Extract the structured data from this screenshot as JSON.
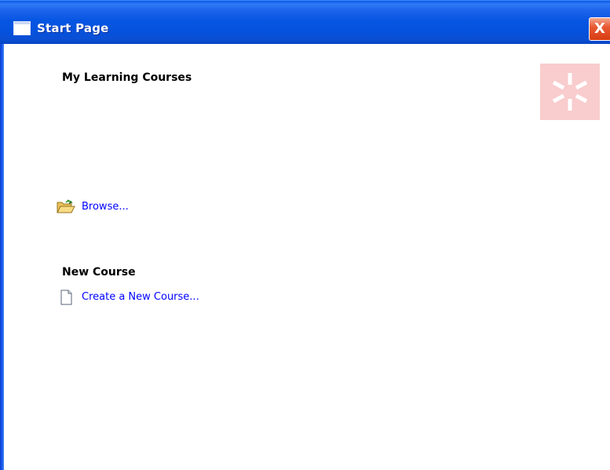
{
  "window": {
    "title": "Start Page",
    "close_label": "X"
  },
  "my_courses": {
    "heading": "My Learning Courses",
    "browse_label": "Browse..."
  },
  "new_course": {
    "heading": "New Course",
    "create_label": "Create a New Course..."
  },
  "icons": {
    "window": "window-icon",
    "close": "close-icon",
    "browse": "open-folder-icon",
    "create": "new-document-icon",
    "logo": "asterisk-logo-icon"
  },
  "colors": {
    "titlebar": "#0552dd",
    "close_button": "#e85a33",
    "link": "#0000ff",
    "logo_background": "#f9cccd"
  }
}
